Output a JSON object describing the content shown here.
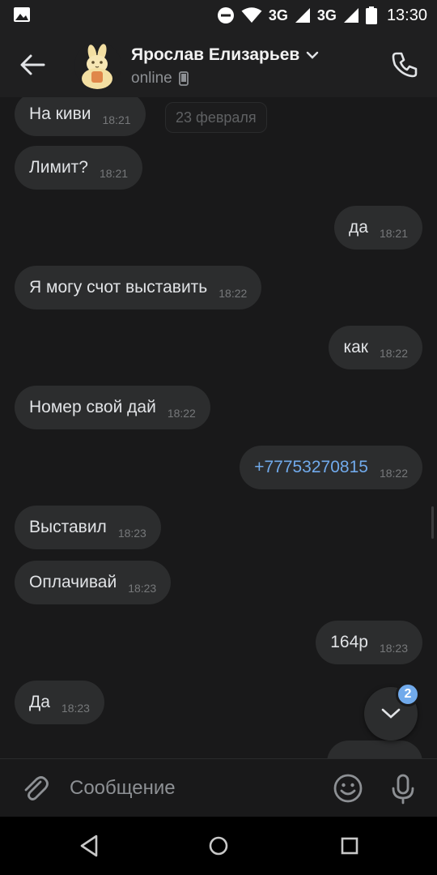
{
  "status_bar": {
    "network_1": "3G",
    "network_2": "3G",
    "time": "13:30"
  },
  "header": {
    "contact_name": "Ярослав Елизарьев",
    "status": "online",
    "icons": [
      "back-arrow-icon",
      "chevron-down-icon",
      "mobile-phone-icon",
      "phone-call-icon"
    ]
  },
  "chat": {
    "date_separator": "23 февраля",
    "messages": [
      {
        "text": "На киви",
        "time": "18:21",
        "outgoing": false
      },
      {
        "text": "Лимит?",
        "time": "18:21",
        "outgoing": false
      },
      {
        "text": "да",
        "time": "18:21",
        "outgoing": true
      },
      {
        "text": "Я могу счот выставить",
        "time": "18:22",
        "outgoing": false
      },
      {
        "text": "как",
        "time": "18:22",
        "outgoing": true
      },
      {
        "text": "Номер свой дай",
        "time": "18:22",
        "outgoing": false
      },
      {
        "text": "+77753270815",
        "time": "18:22",
        "outgoing": true,
        "is_link": true
      },
      {
        "text": "Выставил",
        "time": "18:23",
        "outgoing": false
      },
      {
        "text": "Оплачивай",
        "time": "18:23",
        "outgoing": false
      },
      {
        "text": "164р",
        "time": "18:23",
        "outgoing": true
      },
      {
        "text": "Да",
        "time": "18:23",
        "outgoing": false
      }
    ],
    "unread_count": "2"
  },
  "composer": {
    "placeholder": "Сообщение",
    "icons": [
      "paperclip-icon",
      "emoji-icon",
      "microphone-icon"
    ]
  },
  "colors": {
    "background": "#19191a",
    "bubble": "#2c2d2e",
    "accent": "#71aaeb",
    "text": "#e1e3e6",
    "secondary": "#8d9094"
  }
}
